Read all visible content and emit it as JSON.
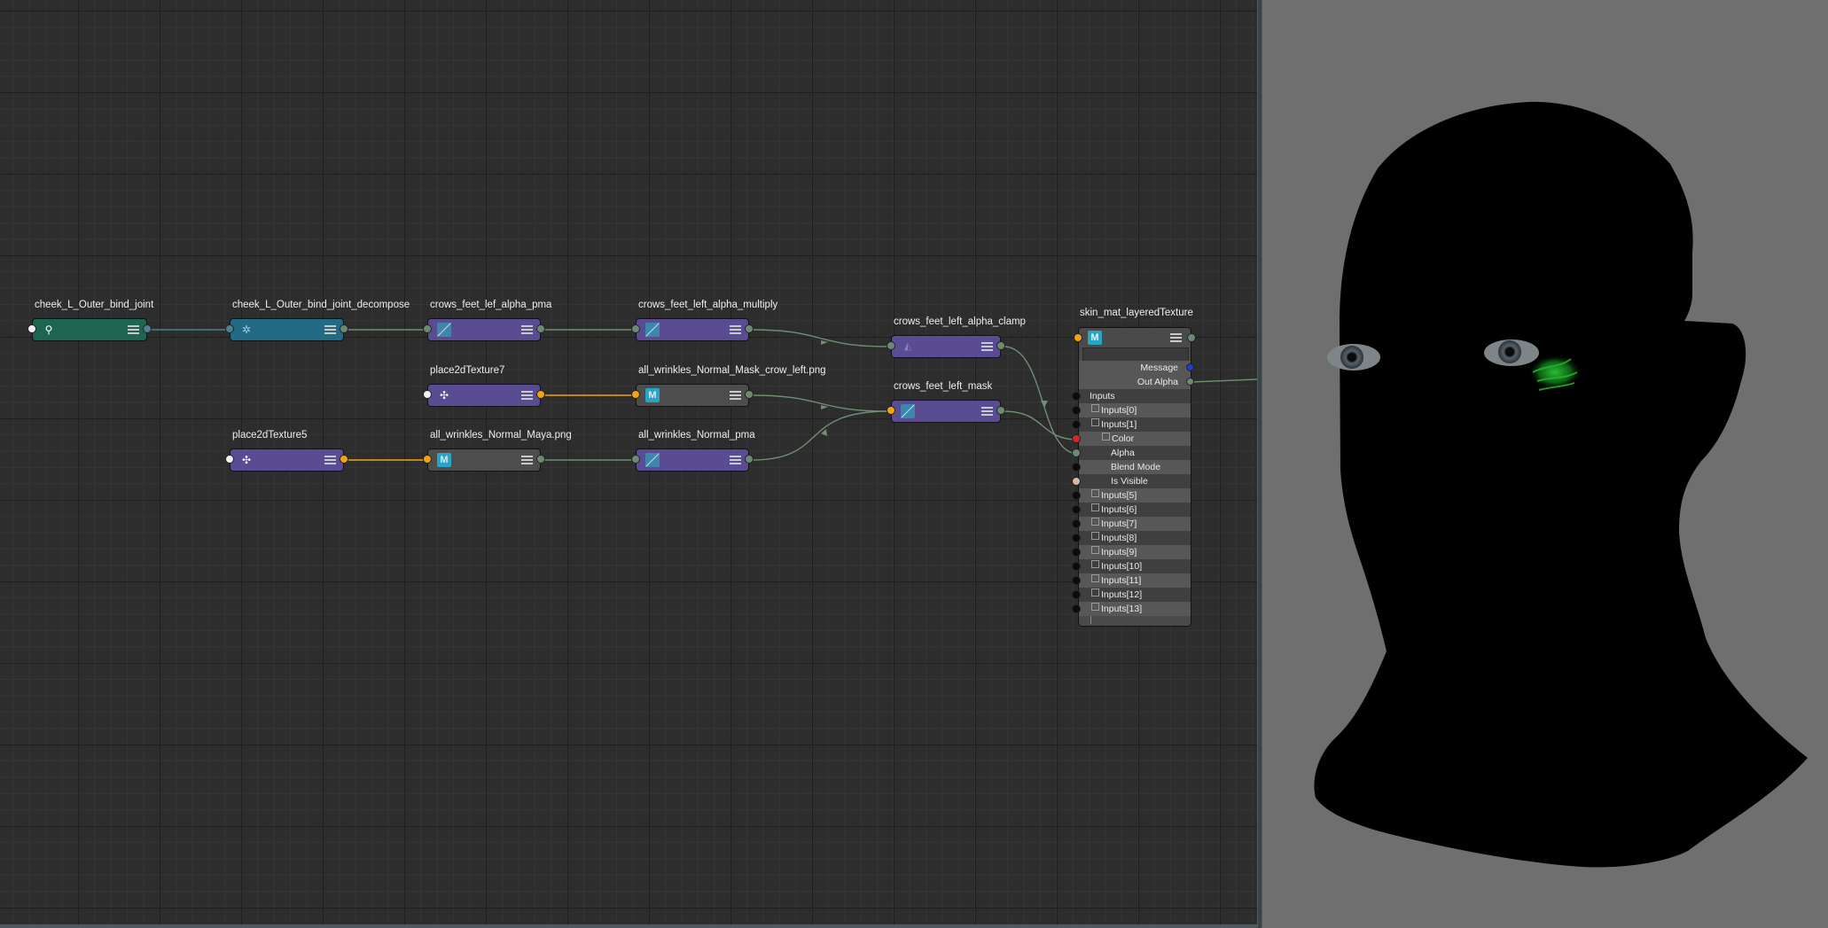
{
  "nodes": {
    "cheek_bind": {
      "label": "cheek_L_Outer_bind_joint",
      "icon": "joint-icon"
    },
    "cheek_decompose": {
      "label": "cheek_L_Outer_bind_joint_decompose",
      "icon": "decompose-icon"
    },
    "alpha_pma": {
      "label": "crows_feet_lef_alpha_pma",
      "icon": "plus-minus-average-icon"
    },
    "alpha_multiply": {
      "label": "crows_feet_left_alpha_multiply",
      "icon": "multiply-divide-icon"
    },
    "alpha_clamp": {
      "label": "crows_feet_left_alpha_clamp",
      "icon": "clamp-icon"
    },
    "place7": {
      "label": "place2dTexture7",
      "icon": "place2d-icon"
    },
    "mask_crow_png": {
      "label": "all_wrinkles_Normal_Mask_crow_left.png",
      "icon": "file-texture-icon",
      "icon_text": "M"
    },
    "left_mask": {
      "label": "crows_feet_left_mask",
      "icon": "multiply-divide-icon"
    },
    "place5": {
      "label": "place2dTexture5",
      "icon": "place2d-icon"
    },
    "normal_maya_png": {
      "label": "all_wrinkles_Normal_Maya.png",
      "icon": "file-texture-icon",
      "icon_text": "M"
    },
    "normal_pma": {
      "label": "all_wrinkles_Normal_pma",
      "icon": "plus-minus-average-icon"
    }
  },
  "layered_texture": {
    "title": "skin_mat_layeredTexture",
    "icon_text": "M",
    "message": "Message",
    "out_alpha": "Out Alpha",
    "inputs_label": "Inputs",
    "rows": [
      "Inputs[0]",
      "Inputs[1]",
      "Color",
      "Alpha",
      "Blend Mode",
      "Is Visible",
      "Inputs[5]",
      "Inputs[6]",
      "Inputs[7]",
      "Inputs[8]",
      "Inputs[9]",
      "Inputs[10]",
      "Inputs[11]",
      "Inputs[12]",
      "Inputs[13]"
    ]
  },
  "colors": {
    "graph_bg": "#2d2d2d",
    "viewport_bg": "#6f6f6f",
    "wire_green": "#6f8f72",
    "wire_orange": "#f2a311",
    "wire_teal": "#4c8190"
  }
}
